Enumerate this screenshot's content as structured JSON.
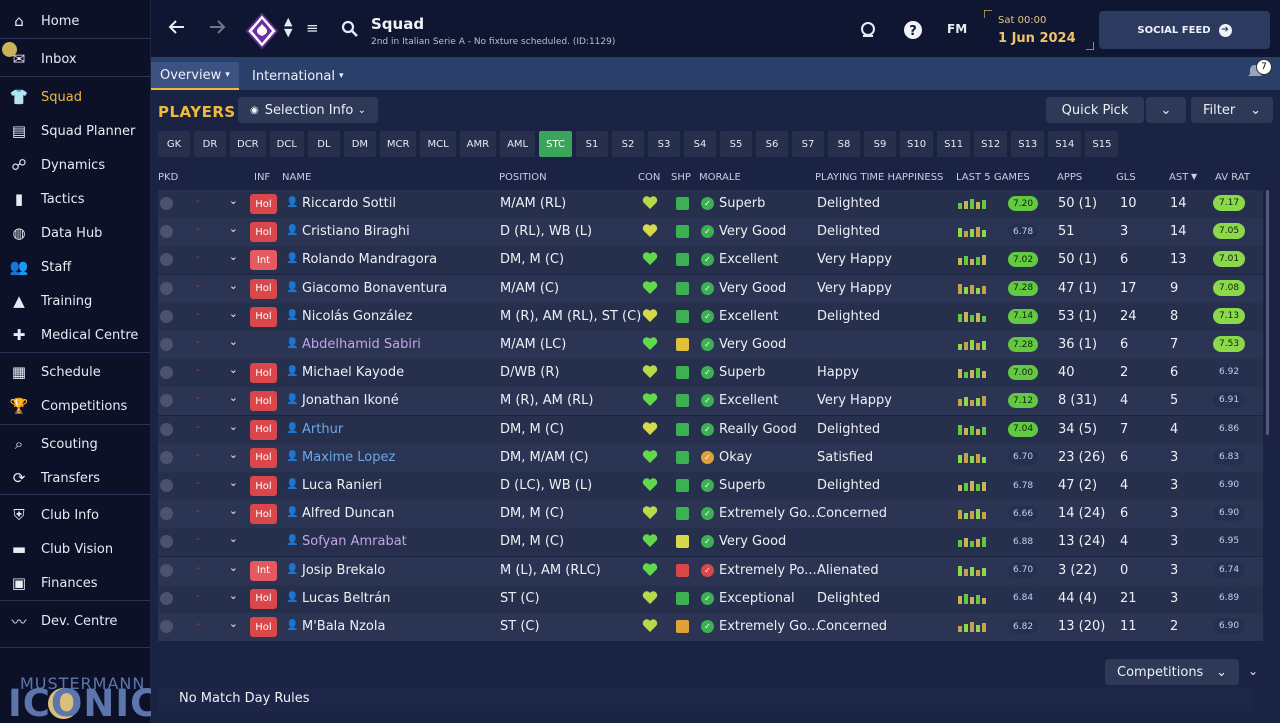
{
  "sidebar": {
    "items": [
      {
        "label": "Home",
        "icon": "home-icon"
      },
      {
        "label": "Inbox",
        "icon": "inbox-icon"
      },
      {
        "label": "Squad",
        "icon": "squad-icon",
        "active": true
      },
      {
        "label": "Squad Planner",
        "icon": "clipboard-icon"
      },
      {
        "label": "Dynamics",
        "icon": "dynamics-icon"
      },
      {
        "label": "Tactics",
        "icon": "tactics-icon"
      },
      {
        "label": "Data Hub",
        "icon": "data-hub-icon"
      },
      {
        "label": "Staff",
        "icon": "staff-icon"
      },
      {
        "label": "Training",
        "icon": "training-icon"
      },
      {
        "label": "Medical Centre",
        "icon": "medical-icon"
      },
      {
        "label": "Schedule",
        "icon": "calendar-icon"
      },
      {
        "label": "Competitions",
        "icon": "trophy-icon"
      },
      {
        "label": "Scouting",
        "icon": "search-icon"
      },
      {
        "label": "Transfers",
        "icon": "transfer-icon"
      },
      {
        "label": "Club Info",
        "icon": "shield-icon"
      },
      {
        "label": "Club Vision",
        "icon": "briefcase-icon"
      },
      {
        "label": "Finances",
        "icon": "money-icon"
      },
      {
        "label": "Dev. Centre",
        "icon": "dev-icon"
      }
    ],
    "logo": {
      "top": "MUSTERMANN",
      "bottom": "ICONIC"
    }
  },
  "header": {
    "title": "Squad",
    "subtitle": "2nd in Italian Serie A - No fixture scheduled. (ID:1129)",
    "fm_label": "FM",
    "date_day": "Sat 00:00",
    "date_full": "1 Jun 2024",
    "social_feed": "SOCIAL FEED"
  },
  "tabs": [
    {
      "label": "Overview",
      "active": true
    },
    {
      "label": "International",
      "active": false
    }
  ],
  "notifications": {
    "count": "7"
  },
  "main": {
    "section_label": "PLAYERS",
    "selection_info": "Selection Info",
    "quick_pick": "Quick Pick",
    "filter": "Filter",
    "position_filters": [
      "GK",
      "DR",
      "DCR",
      "DCL",
      "DL",
      "DM",
      "MCR",
      "MCL",
      "AMR",
      "AML",
      "STC",
      "S1",
      "S2",
      "S3",
      "S4",
      "S5",
      "S6",
      "S7",
      "S8",
      "S9",
      "S10",
      "S11",
      "S12",
      "S13",
      "S14",
      "S15"
    ],
    "selected_filter": "STC",
    "columns": {
      "pkd": "PKD",
      "inf": "INF",
      "name": "NAME",
      "position": "POSITION",
      "con": "CON",
      "shp": "SHP",
      "morale": "MORALE",
      "happiness": "PLAYING TIME HAPPINESS",
      "last5": "LAST 5 GAMES",
      "apps": "APPS",
      "gls": "GLS",
      "ast": "AST",
      "avrat": "AV RAT"
    },
    "sort_column": "AST",
    "competitions_btn": "Competitions",
    "match_day_rules": "No Match Day Rules"
  },
  "players": [
    {
      "pkd": "-",
      "inf": "Hol",
      "name": "Riccardo Sottil",
      "position": "M/AM (RL)",
      "morale": "Superb",
      "happiness": "Delighted",
      "last5": "7.20",
      "last5_green": true,
      "apps": "50 (1)",
      "gls": "10",
      "ast": "14",
      "avrat": "7.17",
      "avrat_green": true,
      "name_style": "normal",
      "morale_color": "#3db054",
      "shp_color": "#3db054",
      "con_color": "#b7d94a"
    },
    {
      "pkd": "-",
      "inf": "Hol",
      "name": "Cristiano Biraghi",
      "position": "D (RL), WB (L)",
      "morale": "Very Good",
      "happiness": "Delighted",
      "last5": "6.78",
      "last5_green": false,
      "apps": "51",
      "gls": "3",
      "ast": "14",
      "avrat": "7.05",
      "avrat_green": true,
      "name_style": "normal",
      "morale_color": "#3db054",
      "shp_color": "#3db054",
      "con_color": "#d6d94a"
    },
    {
      "pkd": "-",
      "inf": "Int",
      "name": "Rolando Mandragora",
      "position": "DM, M (C)",
      "morale": "Excellent",
      "happiness": "Very Happy",
      "last5": "7.02",
      "last5_green": true,
      "apps": "50 (1)",
      "gls": "6",
      "ast": "13",
      "avrat": "7.01",
      "avrat_green": true,
      "name_style": "normal",
      "morale_color": "#3db054",
      "shp_color": "#3db054",
      "con_color": "#62d94a"
    },
    {
      "pkd": "-",
      "inf": "Hol",
      "name": "Giacomo Bonaventura",
      "position": "M/AM (C)",
      "morale": "Very Good",
      "happiness": "Very Happy",
      "last5": "7.28",
      "last5_green": true,
      "apps": "47 (1)",
      "gls": "17",
      "ast": "9",
      "avrat": "7.08",
      "avrat_green": true,
      "name_style": "normal",
      "morale_color": "#3db054",
      "shp_color": "#3db054",
      "con_color": "#62d94a"
    },
    {
      "pkd": "-",
      "inf": "Hol",
      "name": "Nicolás González",
      "position": "M (R), AM (RL), ST (C)",
      "morale": "Excellent",
      "happiness": "Delighted",
      "last5": "7.14",
      "last5_green": true,
      "apps": "53 (1)",
      "gls": "24",
      "ast": "8",
      "avrat": "7.13",
      "avrat_green": true,
      "name_style": "normal",
      "morale_color": "#3db054",
      "shp_color": "#3db054",
      "con_color": "#d6d94a"
    },
    {
      "pkd": "-",
      "inf": "",
      "name": "Abdelhamid Sabiri",
      "position": "M/AM (LC)",
      "morale": "Very Good",
      "happiness": "",
      "last5": "7.28",
      "last5_green": true,
      "apps": "36 (1)",
      "gls": "6",
      "ast": "7",
      "avrat": "7.53",
      "avrat_green": true,
      "name_style": "loan",
      "morale_color": "#3db054",
      "shp_color": "#e0c13a",
      "con_color": "#62d94a"
    },
    {
      "pkd": "-",
      "inf": "Hol",
      "name": "Michael Kayode",
      "position": "D/WB (R)",
      "morale": "Superb",
      "happiness": "Happy",
      "last5": "7.00",
      "last5_green": true,
      "apps": "40",
      "gls": "2",
      "ast": "6",
      "avrat": "6.92",
      "avrat_green": false,
      "name_style": "normal",
      "morale_color": "#3db054",
      "shp_color": "#3db054",
      "con_color": "#b7d94a"
    },
    {
      "pkd": "-",
      "inf": "Hol",
      "name": "Jonathan Ikoné",
      "position": "M (R), AM (RL)",
      "morale": "Excellent",
      "happiness": "Very Happy",
      "last5": "7.12",
      "last5_green": true,
      "apps": "8 (31)",
      "gls": "4",
      "ast": "5",
      "avrat": "6.91",
      "avrat_green": false,
      "name_style": "normal",
      "morale_color": "#3db054",
      "shp_color": "#3db054",
      "con_color": "#62d94a"
    },
    {
      "pkd": "-",
      "inf": "Hol",
      "name": "Arthur",
      "position": "DM, M (C)",
      "morale": "Really Good",
      "happiness": "Delighted",
      "last5": "7.04",
      "last5_green": true,
      "apps": "34 (5)",
      "gls": "7",
      "ast": "4",
      "avrat": "6.86",
      "avrat_green": false,
      "name_style": "blue",
      "morale_color": "#3db054",
      "shp_color": "#3db054",
      "con_color": "#d6d94a"
    },
    {
      "pkd": "-",
      "inf": "Hol",
      "name": "Maxime Lopez",
      "position": "DM, M/AM (C)",
      "morale": "Okay",
      "happiness": "Satisfied",
      "last5": "6.70",
      "last5_green": false,
      "apps": "23 (26)",
      "gls": "6",
      "ast": "3",
      "avrat": "6.83",
      "avrat_green": false,
      "name_style": "blue",
      "morale_color": "#e0a13a",
      "shp_color": "#3db054",
      "con_color": "#62d94a"
    },
    {
      "pkd": "-",
      "inf": "Hol",
      "name": "Luca Ranieri",
      "position": "D (LC), WB (L)",
      "morale": "Superb",
      "happiness": "Delighted",
      "last5": "6.78",
      "last5_green": false,
      "apps": "47 (2)",
      "gls": "4",
      "ast": "3",
      "avrat": "6.90",
      "avrat_green": false,
      "name_style": "normal",
      "morale_color": "#3db054",
      "shp_color": "#3db054",
      "con_color": "#62d94a"
    },
    {
      "pkd": "-",
      "inf": "Hol",
      "name": "Alfred Duncan",
      "position": "DM, M (C)",
      "morale": "Extremely Go...",
      "happiness": "Concerned",
      "last5": "6.66",
      "last5_green": false,
      "apps": "14 (24)",
      "gls": "6",
      "ast": "3",
      "avrat": "6.90",
      "avrat_green": false,
      "name_style": "normal",
      "morale_color": "#3db054",
      "shp_color": "#3db054",
      "con_color": "#b7d94a"
    },
    {
      "pkd": "-",
      "inf": "",
      "name": "Sofyan Amrabat",
      "position": "DM, M (C)",
      "morale": "Very Good",
      "happiness": "",
      "last5": "6.88",
      "last5_green": false,
      "apps": "13 (24)",
      "gls": "4",
      "ast": "3",
      "avrat": "6.95",
      "avrat_green": false,
      "name_style": "loan",
      "morale_color": "#3db054",
      "shp_color": "#d6d94a",
      "con_color": "#62d94a"
    },
    {
      "pkd": "-",
      "inf": "Int",
      "name": "Josip Brekalo",
      "position": "M (L), AM (RLC)",
      "morale": "Extremely Po...",
      "happiness": "Alienated",
      "last5": "6.70",
      "last5_green": false,
      "apps": "3 (22)",
      "gls": "0",
      "ast": "3",
      "avrat": "6.74",
      "avrat_green": false,
      "name_style": "normal",
      "morale_color": "#d9474a",
      "shp_color": "#d9474a",
      "con_color": "#62d94a"
    },
    {
      "pkd": "-",
      "inf": "Hol",
      "name": "Lucas Beltrán",
      "position": "ST (C)",
      "morale": "Exceptional",
      "happiness": "Delighted",
      "last5": "6.84",
      "last5_green": false,
      "apps": "44 (4)",
      "gls": "21",
      "ast": "3",
      "avrat": "6.89",
      "avrat_green": false,
      "name_style": "normal",
      "morale_color": "#3db054",
      "shp_color": "#3db054",
      "con_color": "#b7d94a"
    },
    {
      "pkd": "-",
      "inf": "Hol",
      "name": "M'Bala Nzola",
      "position": "ST (C)",
      "morale": "Extremely Go...",
      "happiness": "Concerned",
      "last5": "6.82",
      "last5_green": false,
      "apps": "13 (20)",
      "gls": "11",
      "ast": "2",
      "avrat": "6.90",
      "avrat_green": false,
      "name_style": "normal",
      "morale_color": "#3db054",
      "shp_color": "#e0a13a",
      "con_color": "#b7d94a"
    }
  ]
}
